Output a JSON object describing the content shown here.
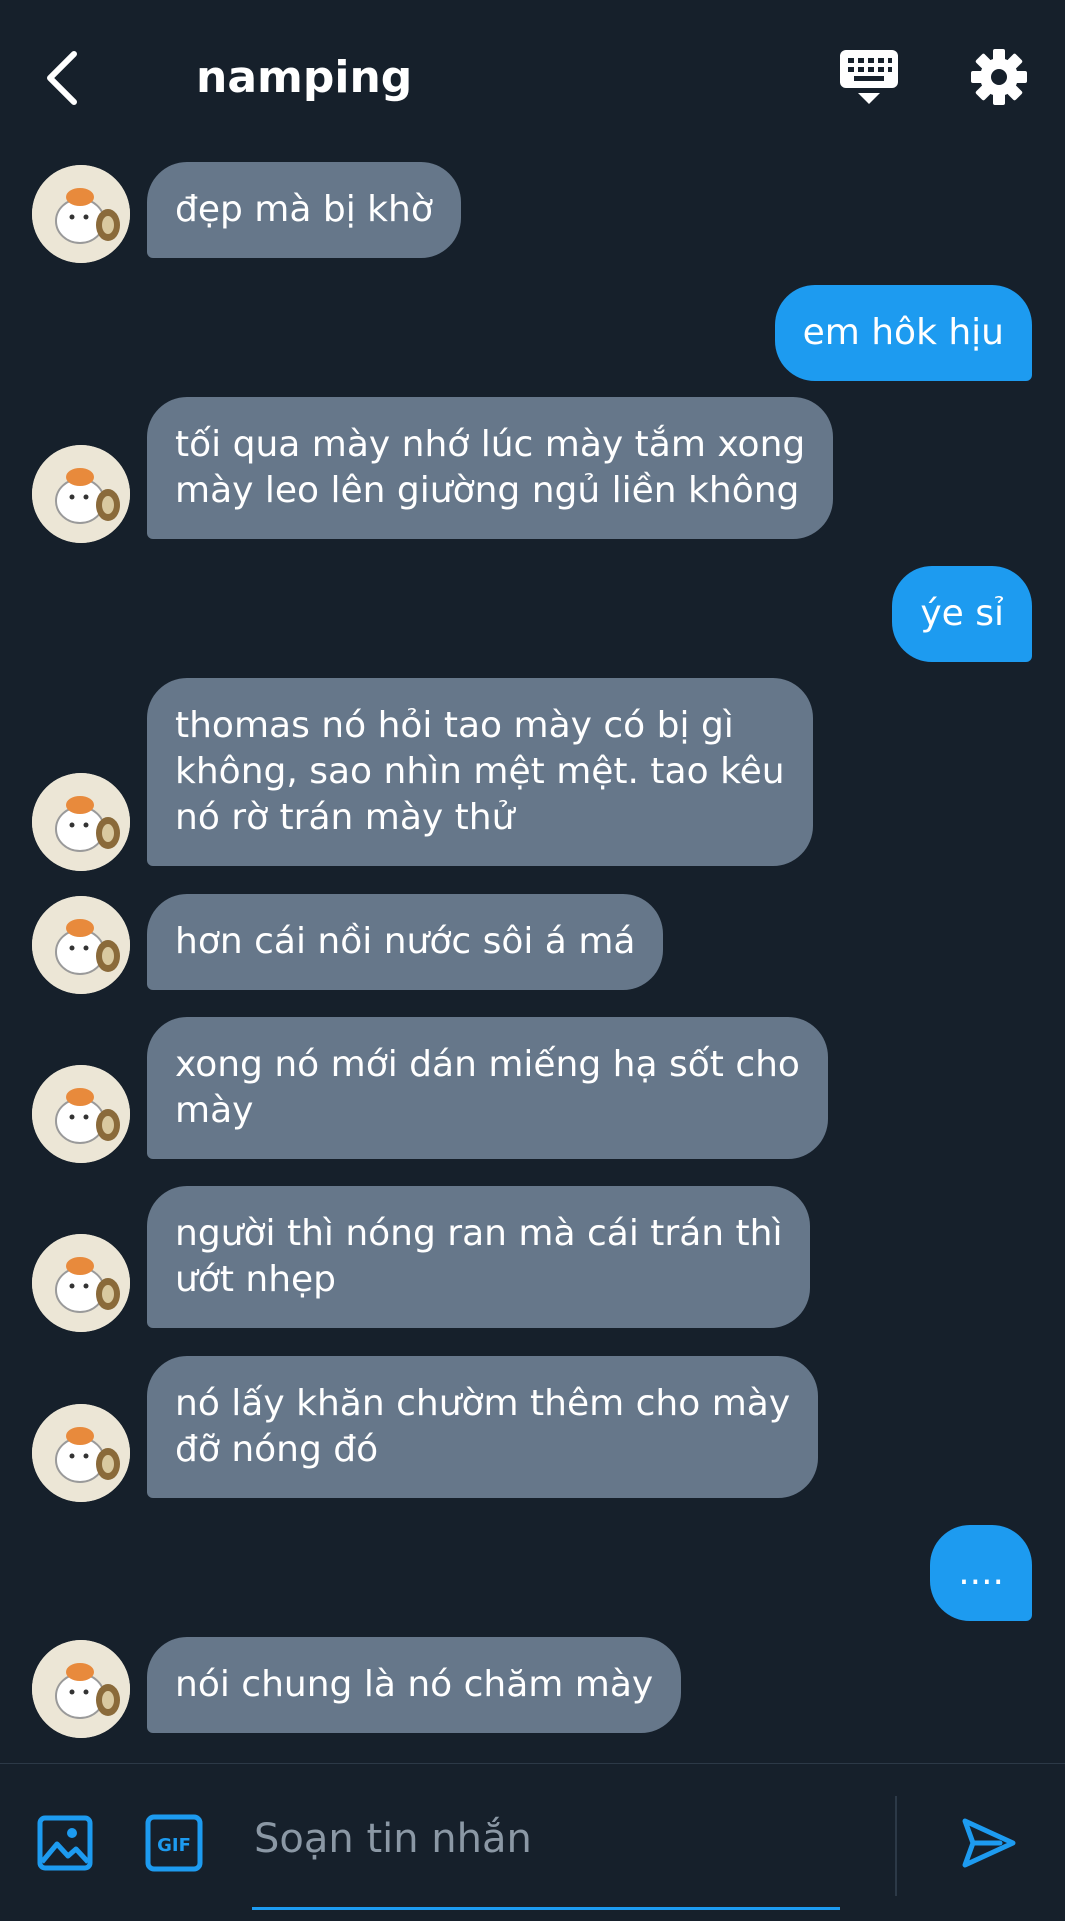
{
  "header": {
    "title": "namping"
  },
  "messages": [
    {
      "side": "in",
      "text": "đẹp mà bị khờ"
    },
    {
      "side": "out",
      "text": "em hôk hịu"
    },
    {
      "side": "in",
      "text": "tối qua mày nhớ lúc mày tắm xong\nmày leo lên giường ngủ liền không"
    },
    {
      "side": "out",
      "text": "ýe sỉ"
    },
    {
      "side": "in",
      "text": "thomas nó hỏi tao mày có bị gì\nkhông, sao nhìn mệt mệt. tao kêu\nnó rờ trán mày thử"
    },
    {
      "side": "in",
      "text": "hơn cái nồi nước sôi á má"
    },
    {
      "side": "in",
      "text": "xong nó mới dán miếng hạ sốt cho\nmày"
    },
    {
      "side": "in",
      "text": "người thì nóng ran mà cái trán thì\nướt nhẹp"
    },
    {
      "side": "in",
      "text": "nó lấy khăn chườm thêm cho mày\nđỡ nóng đó"
    },
    {
      "side": "out",
      "text": "...."
    },
    {
      "side": "in",
      "text": "nói chung là nó chăm mày"
    }
  ],
  "composer": {
    "placeholder": "Soạn tin nhắn",
    "gif_label": "GIF"
  },
  "colors": {
    "background": "#16202b",
    "incoming_bubble": "#66778a",
    "outgoing_bubble": "#1d9bf0",
    "accent": "#1d9bf0"
  },
  "icons": {
    "back": "chevron-left-icon",
    "keyboard": "keyboard-icon",
    "settings": "gear-icon",
    "image": "image-icon",
    "gif": "gif-icon",
    "send": "send-icon"
  }
}
